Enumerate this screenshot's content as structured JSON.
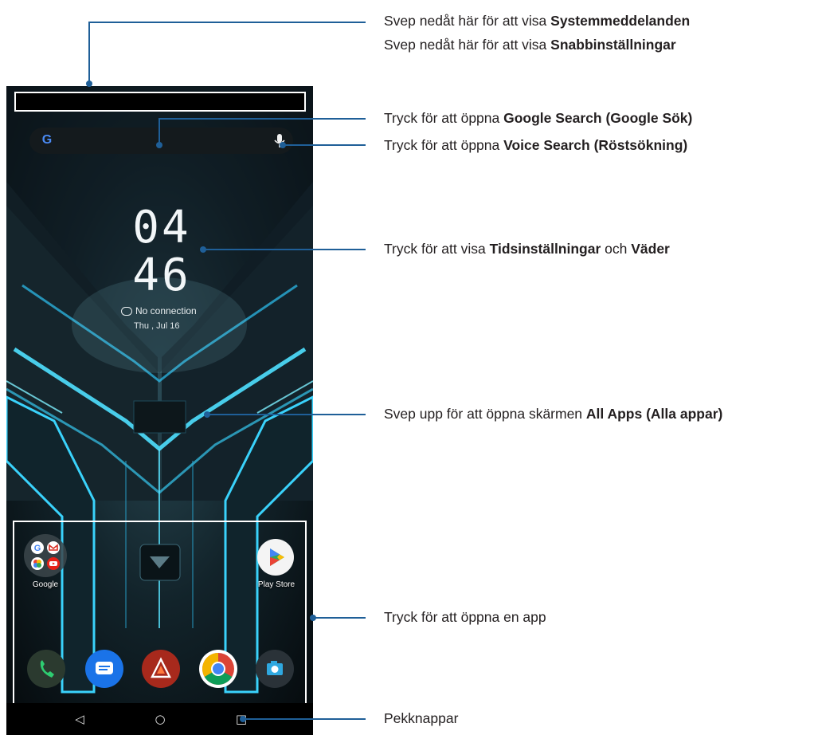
{
  "phone": {
    "clock": {
      "hour": "04",
      "minute": "46"
    },
    "weather_text": "No connection",
    "date_text": "Thu , Jul 16",
    "search": {
      "logo": "G"
    },
    "folder": {
      "label": "Google",
      "icons": [
        "google-icon",
        "gmail-icon",
        "photos-icon",
        "youtube-icon"
      ]
    },
    "play_store": {
      "label": "Play Store"
    },
    "dock": [
      "phone-app-icon",
      "messages-app-icon",
      "armoury-crate-icon",
      "chrome-icon",
      "camera-icon"
    ],
    "nav": {
      "back": "◁",
      "home": "○",
      "recents": "□"
    }
  },
  "callouts": {
    "status_bar_line1_pre": "Svep nedåt här för att visa ",
    "status_bar_line1_bold": "Systemmeddelanden",
    "status_bar_line2_pre": "Svep nedåt här för att visa ",
    "status_bar_line2_bold": "Snabbinställningar",
    "search_pre": "Tryck för att öppna ",
    "search_bold": "Google Search (Google Sök)",
    "voice_pre": "Tryck för att öppna ",
    "voice_bold": "Voice Search (Röstsökning)",
    "clock_pre": "Tryck för att visa ",
    "clock_bold1": "Tidsinställningar",
    "clock_mid": " och  ",
    "clock_bold2": "Väder",
    "allapps_pre": "Svep upp för att öppna skärmen ",
    "allapps_bold": "All Apps (Alla appar)",
    "apps": "Tryck för att öppna en app",
    "nav": "Pekknappar"
  },
  "colors": {
    "leader": "#1f5f98",
    "glow": "#3fd4ff",
    "text": "#231f20"
  }
}
